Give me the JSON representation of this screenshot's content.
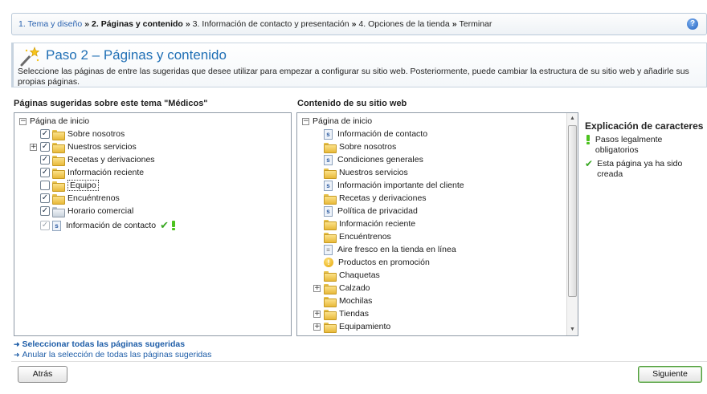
{
  "wizard": {
    "steps": [
      {
        "label": "1. Tema y diseño",
        "state": "link"
      },
      {
        "label": "2. Páginas y contenido",
        "state": "current"
      },
      {
        "label": "3. Información de contacto y presentación",
        "state": "plain"
      },
      {
        "label": "4. Opciones de la tienda",
        "state": "plain"
      },
      {
        "label": "Terminar",
        "state": "plain"
      }
    ],
    "separator": "»",
    "help_icon": "?"
  },
  "header": {
    "title": "Paso 2 – Páginas y contenido",
    "description": "Seleccione las páginas de entre las sugeridas que desee utilizar para empezar a configurar su sitio web. Posteriormente, puede cambiar la estructura de su sitio web y añadirle sus propias páginas."
  },
  "suggested": {
    "title": "Páginas sugeridas sobre este tema \"Médicos\"",
    "root": "Página de inicio",
    "items": [
      {
        "label": "Sobre nosotros",
        "checked": true,
        "icon": "folder-icon",
        "expander": false
      },
      {
        "label": "Nuestros servicios",
        "checked": true,
        "icon": "folder-icon",
        "expander": true
      },
      {
        "label": "Recetas y derivaciones",
        "checked": true,
        "icon": "folder-icon",
        "expander": false
      },
      {
        "label": "Información reciente",
        "checked": true,
        "icon": "folder-icon",
        "expander": false
      },
      {
        "label": "Equipo",
        "checked": false,
        "icon": "folder-icon",
        "expander": false
      },
      {
        "label": "Encuéntrenos",
        "checked": true,
        "icon": "folder-icon",
        "expander": false
      },
      {
        "label": "Horario comercial",
        "checked": true,
        "icon": "grey-folder-icon",
        "expander": false
      },
      {
        "label": "Información de contacto",
        "checked": true,
        "icon": "page-icon",
        "expander": false,
        "disabled": true
      }
    ]
  },
  "content": {
    "title": "Contenido de su sitio web",
    "root": "Página de inicio",
    "items": [
      {
        "label": "Información de contacto",
        "icon": "page-icon",
        "expander": false
      },
      {
        "label": "Sobre nosotros",
        "icon": "folder-icon",
        "expander": false
      },
      {
        "label": "Condiciones generales",
        "icon": "page-icon",
        "expander": false
      },
      {
        "label": "Nuestros servicios",
        "icon": "folder-icon",
        "expander": false
      },
      {
        "label": "Información importante del cliente",
        "icon": "page-icon",
        "expander": false
      },
      {
        "label": "Recetas y derivaciones",
        "icon": "folder-icon",
        "expander": false
      },
      {
        "label": "Política de privacidad",
        "icon": "page-icon",
        "expander": false
      },
      {
        "label": "Información reciente",
        "icon": "folder-icon",
        "expander": false
      },
      {
        "label": "Encuéntrenos",
        "icon": "folder-icon",
        "expander": false
      },
      {
        "label": "Aire fresco en la tienda en línea",
        "icon": "plain-page-icon",
        "expander": false
      },
      {
        "label": "Productos en promoción",
        "icon": "warning-icon",
        "expander": false
      },
      {
        "label": "Chaquetas",
        "icon": "folder-icon",
        "expander": false
      },
      {
        "label": "Calzado",
        "icon": "folder-icon",
        "expander": true
      },
      {
        "label": "Mochilas",
        "icon": "folder-icon",
        "expander": false
      },
      {
        "label": "Tiendas",
        "icon": "folder-icon",
        "expander": true
      },
      {
        "label": "Equipamiento",
        "icon": "folder-icon",
        "expander": true
      }
    ]
  },
  "legend": {
    "title": "Explicación de caracteres",
    "required": "Pasos legalmente obligatorios",
    "created": "Esta página ya ha sido creada"
  },
  "links": {
    "select_all": "Seleccionar todas las páginas sugeridas",
    "deselect_all": "Anular la selección de todas las páginas sugeridas"
  },
  "buttons": {
    "back": "Atrás",
    "next": "Siguiente"
  },
  "colors": {
    "accent_blue": "#1f6fb5",
    "link_blue": "#1f5ea8",
    "success_green": "#3aa824"
  }
}
